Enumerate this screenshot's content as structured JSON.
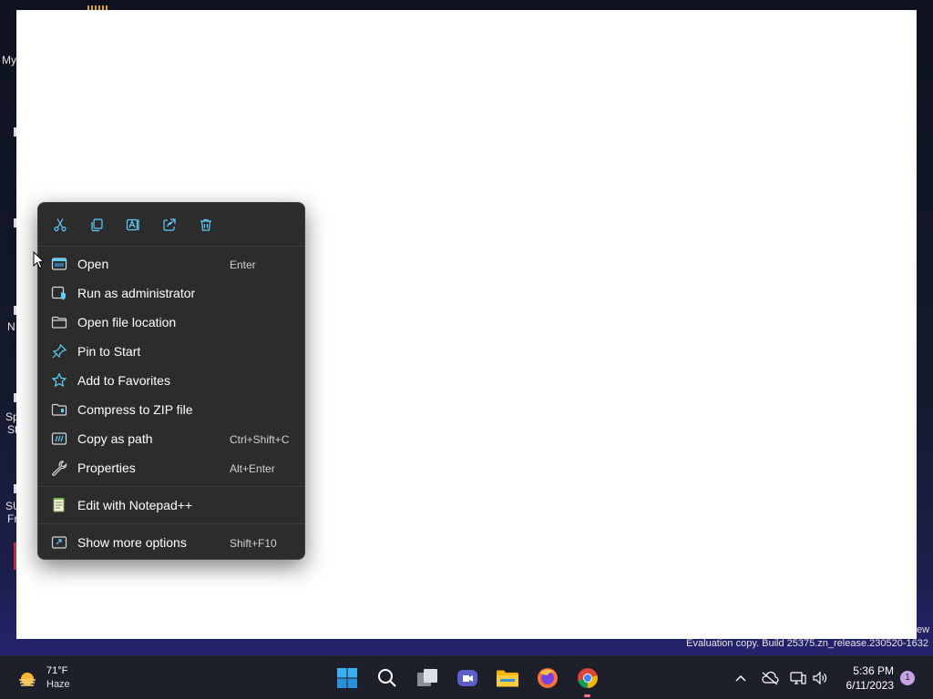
{
  "desktop": {
    "fragments": [
      "My",
      "N",
      "Sp",
      "St",
      "SU",
      "Fr"
    ]
  },
  "eval_watermark": "Evaluation copy. Build 25375.zn_release.230520-1632",
  "eval_fragment": "ew",
  "context_menu": {
    "quick_actions": [
      {
        "name": "cut-icon",
        "label": "Cut"
      },
      {
        "name": "copy-icon",
        "label": "Copy"
      },
      {
        "name": "rename-icon",
        "label": "Rename"
      },
      {
        "name": "share-icon",
        "label": "Share"
      },
      {
        "name": "delete-icon",
        "label": "Delete"
      }
    ],
    "items": [
      {
        "label": "Open",
        "shortcut": "Enter",
        "icon": "open-icon"
      },
      {
        "label": "Run as administrator",
        "shortcut": "",
        "icon": "run-admin-icon"
      },
      {
        "label": "Open file location",
        "shortcut": "",
        "icon": "folder-icon"
      },
      {
        "label": "Pin to Start",
        "shortcut": "",
        "icon": "pin-icon"
      },
      {
        "label": "Add to Favorites",
        "shortcut": "",
        "icon": "star-icon"
      },
      {
        "label": "Compress to ZIP file",
        "shortcut": "",
        "icon": "zip-icon"
      },
      {
        "label": "Copy as path",
        "shortcut": "Ctrl+Shift+C",
        "icon": "copy-path-icon"
      },
      {
        "label": "Properties",
        "shortcut": "Alt+Enter",
        "icon": "wrench-icon"
      },
      {
        "label": "Edit with Notepad++",
        "shortcut": "",
        "icon": "notepadpp-icon"
      },
      {
        "label": "Show more options",
        "shortcut": "Shift+F10",
        "icon": "more-options-icon"
      }
    ]
  },
  "taskbar": {
    "weather": {
      "temp": "71°F",
      "condition": "Haze"
    },
    "apps": [
      "start-icon",
      "search-icon",
      "task-view-icon",
      "teams-icon",
      "file-explorer-icon",
      "firefox-icon",
      "chrome-icon"
    ],
    "clock": {
      "time": "5:36 PM",
      "date": "6/11/2023"
    },
    "notification_count": "1"
  },
  "colors": {
    "menu_bg": "#2c2c2c",
    "accent_blue": "#60cdff",
    "taskbar_bg": "#1d1f2b"
  }
}
